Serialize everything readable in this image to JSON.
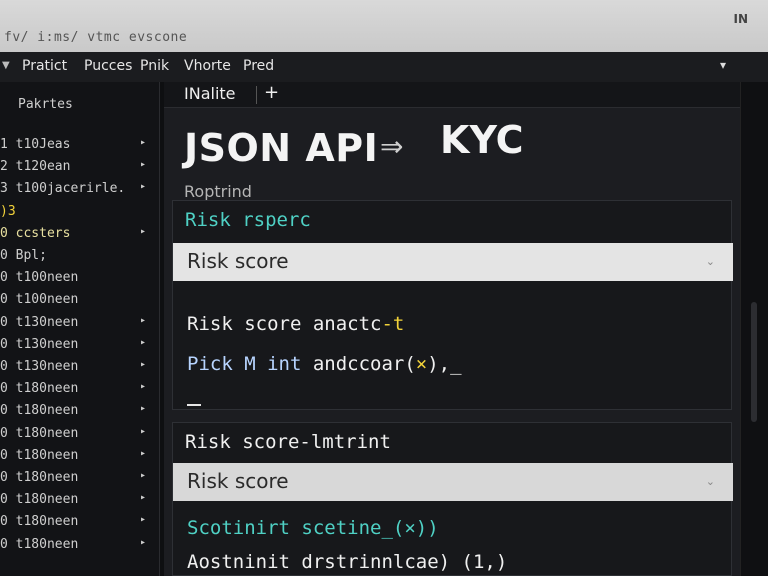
{
  "window": {
    "title": "fv/ i:ms/ vtmc evscone",
    "corner": "IN"
  },
  "menubar": {
    "items": [
      "Pratict",
      "Pucces",
      "Pnik",
      "Vhorte",
      "Pred"
    ],
    "dropdown_icon": "caret-down-icon"
  },
  "sidebar": {
    "header": "Pakrtes",
    "items": [
      {
        "text": "1  t10Jeas",
        "arrow": true
      },
      {
        "text": "2  t120ean",
        "arrow": true
      },
      {
        "text": "3  t100jacerirle.",
        "arrow": true
      },
      {
        "text": "    )3",
        "arrow": false
      },
      {
        "text": "0  ccsters",
        "arrow": true
      },
      {
        "text": "0  Bpl;",
        "arrow": false
      },
      {
        "text": "0  t100neen",
        "arrow": false
      },
      {
        "text": "0  t100neen",
        "arrow": false
      },
      {
        "text": "0  t130neen",
        "arrow": true
      },
      {
        "text": "0  t130neen",
        "arrow": true
      },
      {
        "text": "0  t130neen",
        "arrow": true
      },
      {
        "text": "0  t180neen",
        "arrow": true
      },
      {
        "text": "0  t180neen",
        "arrow": true
      },
      {
        "text": "0  t180neen",
        "arrow": true
      },
      {
        "text": "0  t180neen",
        "arrow": true
      },
      {
        "text": "0  t180neen",
        "arrow": true
      },
      {
        "text": "0  t180neen",
        "arrow": true
      },
      {
        "text": "0  t180neen",
        "arrow": true
      },
      {
        "text": "0  t180neen",
        "arrow": true
      }
    ]
  },
  "tabbar": {
    "active_tab": "INalite",
    "add_label": "+"
  },
  "page": {
    "title_left": "JSON API",
    "arrow": "⇒",
    "title_right": "KYC",
    "subtitle": "Roptrind"
  },
  "panel1": {
    "heading": "Risk rsperc",
    "select_value": "Risk score",
    "line1_prefix": "Risk score",
    "line1_code": " anactc",
    "line1_highlight": "-t",
    "line2_prefix": "Pick M int",
    "line2_code": " andccoar(",
    "line2_highlight": "×",
    "line2_suffix": "),_",
    "accent_yellow": "#f2d23a",
    "accent_teal": "#4fd1c5"
  },
  "panel2": {
    "heading": "Risk score-lmtrint",
    "select_value": "Risk score",
    "line1": "Scotinirt scetine_(×))",
    "line2": "Aostninit drstrinnlcae) (1,)"
  }
}
